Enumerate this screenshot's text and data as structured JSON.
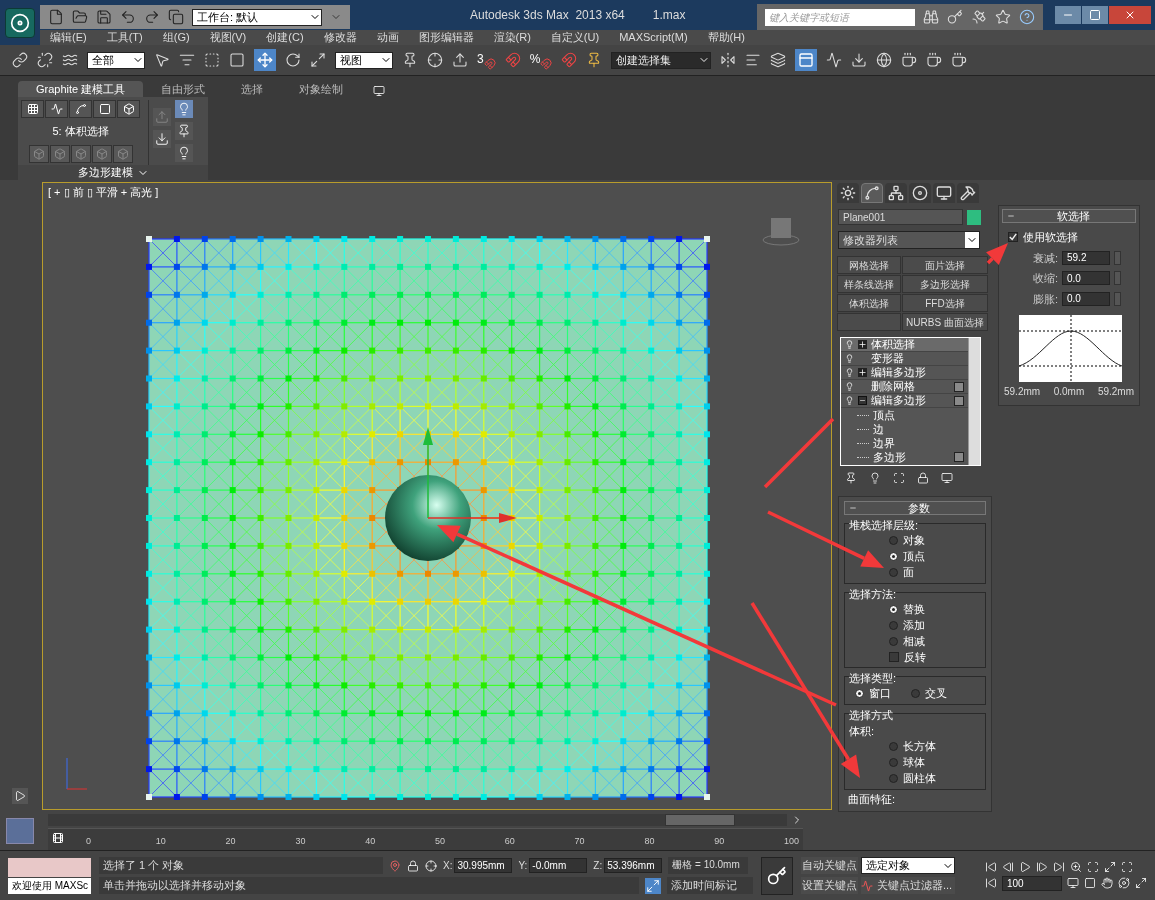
{
  "title_bar": {
    "workspace": "工作台: 默认",
    "app_title": "Autodesk 3ds Max  2013 x64",
    "file": "1.max",
    "search_placeholder": "键入关键字或短语"
  },
  "menu": [
    "编辑(E)",
    "工具(T)",
    "组(G)",
    "视图(V)",
    "创建(C)",
    "修改器",
    "动画",
    "图形编辑器",
    "渲染(R)",
    "自定义(U)",
    "MAXScript(M)",
    "帮助(H)"
  ],
  "toolbar": {
    "selection_filter": "全部",
    "reference_coord": "视图",
    "snap_label": "3",
    "percent_label": "%",
    "named_selection": "创建选择集"
  },
  "ribbon": {
    "tabs": [
      {
        "label": "Graphite 建模工具",
        "selected": true
      },
      {
        "label": "自由形式",
        "selected": false
      },
      {
        "label": "选择",
        "selected": false
      },
      {
        "label": "对象绘制",
        "selected": false
      }
    ],
    "level_label": "5: 体积选择",
    "panel_title": "多边形建模"
  },
  "viewport": {
    "label": "[ + ▯ 前 ▯ 平滑 + 高光 ]"
  },
  "command_panel": {
    "tabs": [
      {
        "kind": "create",
        "selected": false
      },
      {
        "kind": "modify",
        "selected": true
      },
      {
        "kind": "hierarchy",
        "selected": false
      },
      {
        "kind": "motion",
        "selected": false
      },
      {
        "kind": "display",
        "selected": false
      },
      {
        "kind": "utilities",
        "selected": false
      }
    ],
    "object_name": "Plane001",
    "modifier_list": "修改器列表",
    "modifier_buttons": [
      {
        "kind": "button",
        "label": "网格选择"
      },
      {
        "kind": "button",
        "label": "面片选择"
      },
      {
        "kind": "button",
        "label": "样条线选择"
      },
      {
        "kind": "button",
        "label": "多边形选择"
      },
      {
        "kind": "button",
        "label": "体积选择"
      },
      {
        "kind": "button",
        "label": "FFD选择"
      },
      {
        "kind": "blank"
      },
      {
        "kind": "button",
        "label": "NURBS 曲面选择"
      }
    ],
    "stack": [
      {
        "label": "体积选择",
        "expanded": false,
        "selected": true
      },
      {
        "label": "变形器",
        "selected": false
      },
      {
        "label": "编辑多边形",
        "expanded": false,
        "selected": false
      },
      {
        "label": "删除网格",
        "toggle": true,
        "selected": false
      },
      {
        "label": "编辑多边形",
        "expanded": true,
        "toggle": true,
        "selected": false,
        "children": [
          {
            "label": "顶点"
          },
          {
            "label": "边"
          },
          {
            "label": "边界"
          },
          {
            "label": "多边形",
            "toggle": true
          }
        ]
      }
    ]
  },
  "parameters": {
    "title": "参数",
    "groups": [
      {
        "title": "堆栈选择层级:",
        "items": [
          {
            "kind": "radio",
            "label": "对象",
            "selected": false
          },
          {
            "kind": "radio",
            "label": "顶点",
            "selected": true
          },
          {
            "kind": "radio",
            "label": "面",
            "selected": false
          }
        ]
      },
      {
        "title": "选择方法:",
        "items": [
          {
            "kind": "radio",
            "label": "替换",
            "selected": true
          },
          {
            "kind": "radio",
            "label": "添加",
            "selected": false
          },
          {
            "kind": "radio",
            "label": "相减",
            "selected": false
          },
          {
            "kind": "checkbox",
            "label": "反转",
            "checked": false
          }
        ]
      },
      {
        "title": "选择类型:",
        "inline": true,
        "items": [
          {
            "kind": "radio",
            "label": "窗口",
            "selected": true
          },
          {
            "kind": "radio",
            "label": "交叉",
            "selected": false
          }
        ]
      },
      {
        "title": "选择方式",
        "subtitle": "体积:",
        "items": [
          {
            "kind": "radio",
            "label": "长方体",
            "selected": false
          },
          {
            "kind": "radio",
            "label": "球体",
            "selected": false
          },
          {
            "kind": "radio",
            "label": "圆柱体",
            "selected": false
          }
        ]
      },
      {
        "title": "曲面特征:"
      }
    ]
  },
  "soft_selection": {
    "title": "软选择",
    "use": {
      "label": "使用软选择",
      "checked": true
    },
    "fields": [
      {
        "label": "衰减:",
        "value": "59.2"
      },
      {
        "label": "收缩:",
        "value": "0.0"
      },
      {
        "label": "膨胀:",
        "value": "0.0"
      }
    ],
    "curve_labels": [
      "59.2mm",
      "0.0mm",
      "59.2mm"
    ]
  },
  "timeline": {
    "level": 0.93,
    "ticks": [
      "0",
      "10",
      "20",
      "30",
      "40",
      "50",
      "60",
      "70",
      "80",
      "90",
      "100"
    ]
  },
  "status": {
    "listener": "欢迎使用 MAXSc",
    "selected_info": "选择了 1 个 对象",
    "prompt": "单击并拖动以选择并移动对象",
    "coords": [
      {
        "axis": "X:",
        "value": "30.995mm"
      },
      {
        "axis": "Y:",
        "value": "-0.0mm"
      },
      {
        "axis": "Z:",
        "value": "53.396mm"
      }
    ],
    "grid": "栅格 = 10.0mm",
    "add_time_tag": "添加时间标记",
    "auto_key": "自动关键点",
    "set_key": "设置关键点",
    "key_mode": "选定对象",
    "key_filters": "关键点过滤器...",
    "frame": "100"
  }
}
